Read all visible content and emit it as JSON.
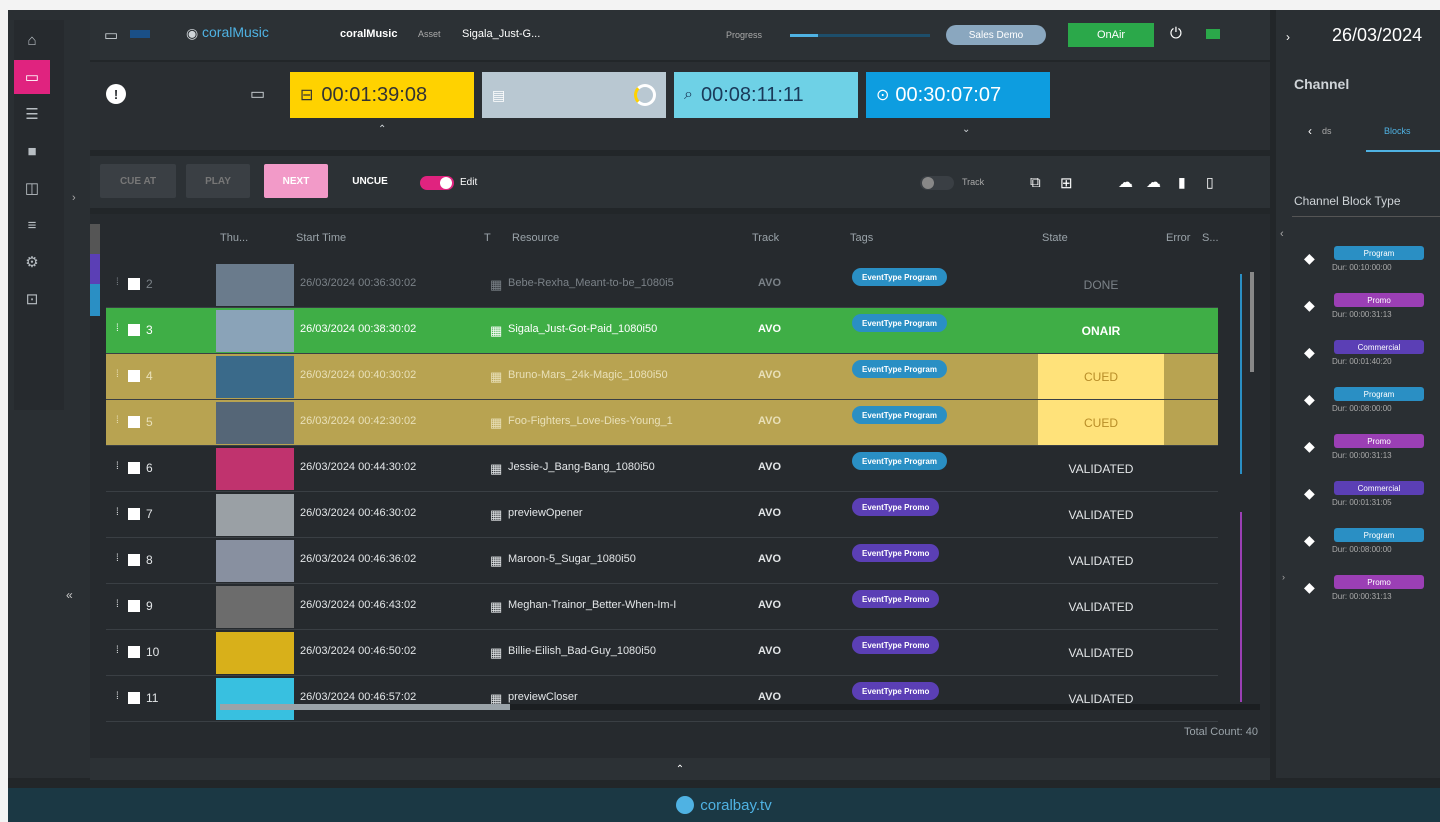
{
  "topbar": {
    "logo_text": "coralMusic",
    "app_name": "coralMusic",
    "asset_label": "Asset",
    "asset_value": "Sigala_Just-G...",
    "progress_label": "Progress",
    "progress_value": 0.2,
    "user": "Sales Demo",
    "onair": "OnAir",
    "date": "26/03/2024"
  },
  "timers": {
    "t1": "00:01:39:08",
    "t2": "00:08:11:11",
    "t3": "00:30:07:07"
  },
  "cuebar": {
    "cue_at": "CUE AT",
    "play": "PLAY",
    "next": "NEXT",
    "uncue": "UNCUE",
    "edit": "Edit",
    "track": "Track"
  },
  "table": {
    "headers": [
      "Thu...",
      "Start Time",
      "T",
      "Resource",
      "Track",
      "Tags",
      "State",
      "Error",
      "S..."
    ],
    "rows": [
      {
        "num": "2",
        "start": "26/03/2024 00:36:30:02",
        "resource": "Bebe-Rexha_Meant-to-be_1080i5",
        "track": "AVO",
        "tag": "EventType Program",
        "state": "DONE",
        "style": "done"
      },
      {
        "num": "3",
        "start": "26/03/2024 00:38:30:02",
        "resource": "Sigala_Just-Got-Paid_1080i50",
        "track": "AVO",
        "tag": "EventType Program",
        "state": "ONAIR",
        "style": "onair"
      },
      {
        "num": "4",
        "start": "26/03/2024 00:40:30:02",
        "resource": "Bruno-Mars_24k-Magic_1080i50",
        "track": "AVO",
        "tag": "EventType Program",
        "state": "CUED",
        "style": "cued"
      },
      {
        "num": "5",
        "start": "26/03/2024 00:42:30:02",
        "resource": "Foo-Fighters_Love-Dies-Young_1",
        "track": "AVO",
        "tag": "EventType Program",
        "state": "CUED",
        "style": "cued"
      },
      {
        "num": "6",
        "start": "26/03/2024 00:44:30:02",
        "resource": "Jessie-J_Bang-Bang_1080i50",
        "track": "AVO",
        "tag": "EventType Program",
        "state": "VALIDATED",
        "style": "normal"
      },
      {
        "num": "7",
        "start": "26/03/2024 00:46:30:02",
        "resource": "previewOpener",
        "track": "AVO",
        "tag": "EventType Promo",
        "state": "VALIDATED",
        "style": "normal"
      },
      {
        "num": "8",
        "start": "26/03/2024 00:46:36:02",
        "resource": "Maroon-5_Sugar_1080i50",
        "track": "AVO",
        "tag": "EventType Promo",
        "state": "VALIDATED",
        "style": "normal"
      },
      {
        "num": "9",
        "start": "26/03/2024 00:46:43:02",
        "resource": "Meghan-Trainor_Better-When-Im-I",
        "track": "AVO",
        "tag": "EventType Promo",
        "state": "VALIDATED",
        "style": "normal"
      },
      {
        "num": "10",
        "start": "26/03/2024 00:46:50:02",
        "resource": "Billie-Eilish_Bad-Guy_1080i50",
        "track": "AVO",
        "tag": "EventType Promo",
        "state": "VALIDATED",
        "style": "normal"
      },
      {
        "num": "11",
        "start": "26/03/2024 00:46:57:02",
        "resource": "previewCloser",
        "track": "AVO",
        "tag": "EventType Promo",
        "state": "VALIDATED",
        "style": "normal"
      }
    ],
    "total": "Total Count: 40"
  },
  "right": {
    "title": "Channel",
    "nav_back": "ds",
    "nav_tab": "Blocks",
    "block_type": "Channel Block Type",
    "blocks": [
      {
        "label": "Program",
        "dur": "Dur: 00:10:00:00",
        "color": "#2a8fc4"
      },
      {
        "label": "Promo",
        "dur": "Dur: 00:00:31:13",
        "color": "#9b3fb5"
      },
      {
        "label": "Commercial",
        "dur": "Dur: 00:01:40:20",
        "color": "#5b3fb5"
      },
      {
        "label": "Program",
        "dur": "Dur: 00:08:00:00",
        "color": "#2a8fc4"
      },
      {
        "label": "Promo",
        "dur": "Dur: 00:00:31:13",
        "color": "#9b3fb5"
      },
      {
        "label": "Commercial",
        "dur": "Dur: 00:01:31:05",
        "color": "#5b3fb5"
      },
      {
        "label": "Program",
        "dur": "Dur: 00:08:00:00",
        "color": "#2a8fc4"
      },
      {
        "label": "Promo",
        "dur": "Dur: 00:00:31:13",
        "color": "#9b3fb5"
      }
    ]
  },
  "footer": {
    "brand": "coralbay.tv"
  }
}
